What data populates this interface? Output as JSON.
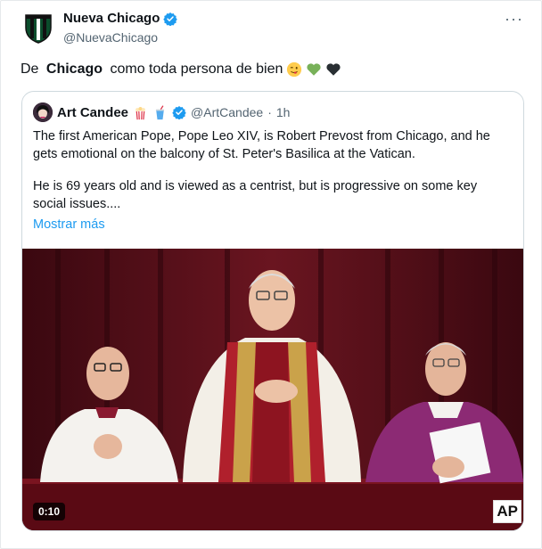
{
  "tweet": {
    "author_name": "Nueva Chicago",
    "author_handle": "@NuevaChicago",
    "text_before": "De ",
    "text_bold": "Chicago",
    "text_after": " como toda persona de bien",
    "emojis": [
      "winking-face-with-tongue",
      "green-heart",
      "black-heart"
    ],
    "more_label": "···"
  },
  "quote": {
    "author_name": "Art Candee",
    "author_emojis": [
      "popcorn",
      "cup-with-straw"
    ],
    "author_handle": "@ArtCandee",
    "separator": "·",
    "time": "1h",
    "paragraph1": "The first American Pope, Pope Leo XIV, is Robert Prevost from Chicago, and he gets emotional on the balcony of St. Peter's Basilica at the Vatican.",
    "paragraph2": "He is 69 years old and is viewed as a centrist, but is progressive on some key social issues....",
    "show_more": "Mostrar más",
    "video_duration": "0:10",
    "watermark": "AP"
  },
  "colors": {
    "link": "#1d9bf0",
    "verified": "#1d9bf0",
    "muted": "#536471",
    "curtain": "#4a0d14"
  }
}
